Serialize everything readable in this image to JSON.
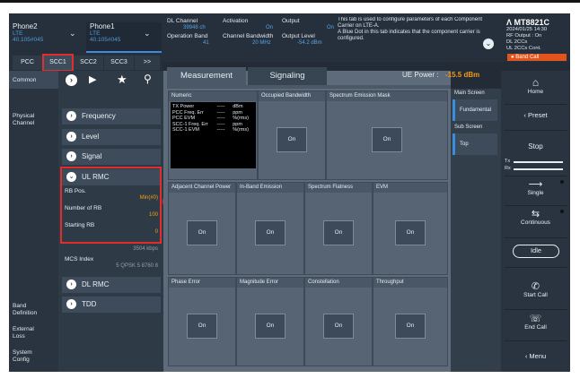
{
  "header": {
    "phone2": {
      "name": "Phone2",
      "tech": "LTE",
      "ip": "40.105#045"
    },
    "phone1": {
      "name": "Phone1",
      "tech": "LTE",
      "ip": "40.105#045"
    },
    "dl_channel": {
      "label": "DL Channel",
      "value": "39948 ch"
    },
    "activation": {
      "label": "Activation",
      "value": "On"
    },
    "output": {
      "label": "Output",
      "value": "On"
    },
    "operation_band": {
      "label": "Operation Band",
      "value": "41"
    },
    "channel_bandwidth": {
      "label": "Channel Bandwidth",
      "value": "20 MHz"
    },
    "output_level": {
      "label": "Output Level",
      "value": "-54.2 dBm"
    },
    "info_line1": "This tab is used to configure parameters of each Component",
    "info_line2": "Carrier on LTE-A.",
    "info_line3": "A Blue Dot in this tab indicates that the component carrier is",
    "info_line4": "configured.",
    "logo": "MT8821C",
    "date": "2024/01/25 14:30",
    "rf_output": "RF Output : On",
    "dl_ccs": "DL 2CCs",
    "ul_ccs": "UL 2CCs Cont.",
    "band_call": "Band Call"
  },
  "cc_tabs": [
    "PCC",
    "SCC1",
    "SCC2",
    "SCC3",
    ">>"
  ],
  "annotations": {
    "one": "1",
    "two": "2"
  },
  "left_nav": {
    "common": "Common",
    "physical": "Physical",
    "channel": "Channel",
    "band1": "Band",
    "band2": "Definition",
    "ext1": "External",
    "ext2": "Loss",
    "sys1": "System",
    "sys2": "Config"
  },
  "mid_panel": {
    "frequency": "Frequency",
    "level": "Level",
    "signal": "Signal",
    "ul_rmc": "UL RMC",
    "rb_pos_label": "RB Pos.",
    "rb_pos_value": "Min(#0)",
    "num_rb_label": "Number of RB",
    "num_rb_value": "100",
    "start_rb_label": "Starting RB",
    "start_rb_value": "0",
    "max_ul_throughput": "3504 kbps",
    "mcs_label": "MCS Index",
    "mcs_value": "5  QPSK  5  8760  8",
    "dl_rmc": "DL RMC",
    "tdd": "TDD"
  },
  "main_tabs": {
    "measurement": "Measurement",
    "signaling": "Signaling"
  },
  "ue_power": {
    "label": "UE Power :",
    "value": "-15.5 dBm"
  },
  "cells": {
    "numeric": "Numeric",
    "occupied_bw": "Occupied Bandwidth",
    "sem": "Spectrum Emission Mask",
    "aclr": "Adjacent Channel Power",
    "inband": "In-Band Emission",
    "flatness": "Spectrum Flatness",
    "evm": "EVM",
    "phase_error": "Phase Error",
    "mag_error": "Magnitude Error",
    "constellation": "Constellation",
    "throughput": "Throughput",
    "on": "On"
  },
  "numeric_rows": [
    {
      "name": "TX Power",
      "val": "-----",
      "unit": "dBm"
    },
    {
      "name": "PCC   Freq. Err",
      "val": "-----",
      "unit": "ppm"
    },
    {
      "name": "PCC   EVM",
      "val": "-----",
      "unit": "%(rms)"
    },
    {
      "name": "SCC-1  Freq. Err",
      "val": "-----",
      "unit": "ppm"
    },
    {
      "name": "SCC-1  EVM",
      "val": "-----",
      "unit": "%(rms)"
    }
  ],
  "side_screens": {
    "main": "Main Screen",
    "fundamental": "Fundamental",
    "sub": "Sub Screen",
    "top": "Top"
  },
  "right_panel": {
    "home": "Home",
    "preset": "Preset",
    "stop": "Stop",
    "tx": "Tx",
    "rx": "Rx",
    "single": "Single",
    "continuous": "Continuous",
    "idle": "Idle",
    "start_call": "Start Call",
    "end_call": "End Call",
    "menu": "Menu"
  }
}
